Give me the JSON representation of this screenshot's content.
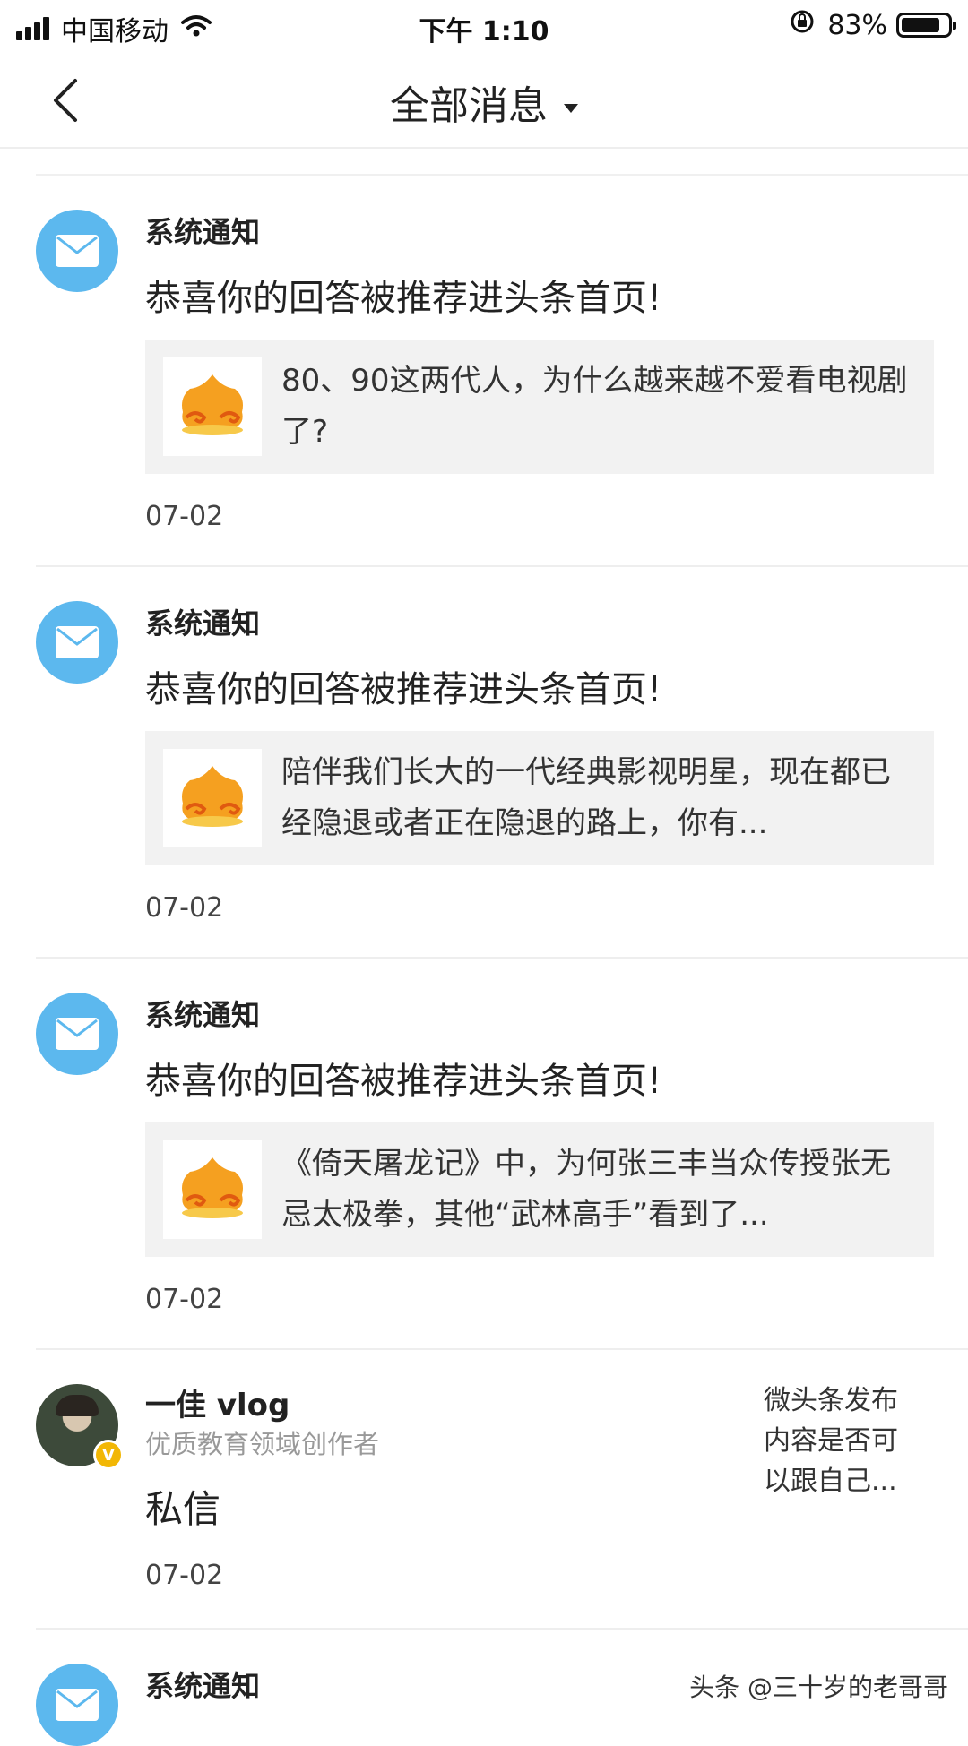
{
  "status_bar": {
    "carrier": "中国移动",
    "time": "下午 1:10",
    "battery_percent": "83%",
    "battery_level": 0.83
  },
  "nav": {
    "title": "全部消息"
  },
  "messages": [
    {
      "sender": "系统通知",
      "title": "恭喜你的回答被推荐进头条首页!",
      "card_text": "80、90这两代人，为什么越来越不爱看电视剧了?",
      "date": "07-02"
    },
    {
      "sender": "系统通知",
      "title": "恭喜你的回答被推荐进头条首页!",
      "card_text": "陪伴我们长大的一代经典影视明星，现在都已经隐退或者正在隐退的路上，你有...",
      "date": "07-02"
    },
    {
      "sender": "系统通知",
      "title": "恭喜你的回答被推荐进头条首页!",
      "card_text": "《倚天屠龙记》中，为何张三丰当众传授张无忌太极拳，其他“武林高手”看到了...",
      "date": "07-02"
    }
  ],
  "private_message": {
    "user_name": "一佳 vlog",
    "user_desc": "优质教育领域创作者",
    "label": "私信",
    "date": "07-02",
    "preview": "微头条发布内容是否可以跟自己..."
  },
  "partial_message": {
    "sender": "系统通知"
  },
  "watermark": "头条 @三十岁的老哥哥",
  "icons": {
    "back": "chevron-left-icon",
    "mail": "mail-icon",
    "thumb": "toutiao-cloud-icon"
  },
  "colors": {
    "mail_avatar": "#5cb8ee",
    "card_bg": "#f2f2f2",
    "verified": "#f2b705"
  }
}
